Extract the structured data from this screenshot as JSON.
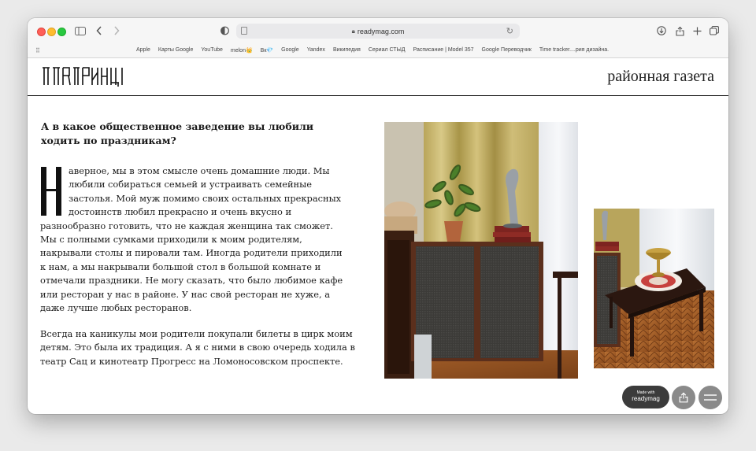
{
  "browser": {
    "url": "readymag.com",
    "favorites": [
      "Apple",
      "Карты Google",
      "YouTube",
      "melon👑",
      "Вк💎",
      "Google",
      "Yandex",
      "Википедия",
      "Сериал СТЫД",
      "Расписание | Model 357",
      "Google Переводчик",
      "Time tracker....рия дизайна."
    ]
  },
  "site": {
    "tagline": "районная газета"
  },
  "article": {
    "question": "А в какое общественное заведение вы любили ходить по праздникам?",
    "paragraph1_rest": "аверное, мы в этом смысле очень домашние люди. Мы любили собираться семьей и устраивать семейные застолья. Мой муж помимо своих остальных прекрасных достоинств любил прекрасно и очень вкусно и разнообразно готовить, что не каждая женщина так сможет. Мы с полными сумками приходили к моим родителям, накрывали столы и пировали там. Иногда родители приходили к нам, а мы накрывали большой стол в большой комнате и отмечали праздники. Не могу сказать, что было любимое кафе или ресторан у нас в районе. У нас свой ресторан не хуже, а даже лучше любых ресторанов.",
    "paragraph2": "Всегда на каникулы мои родители покупали билеты в цирк моим детям. Это была их традиция. А я с ними в свою очередь ходила в театр Сац и кинотеатр Прогресс на Ломоносовском проспекте."
  },
  "footer": {
    "made_with_small": "Made with",
    "made_with_brand": "readymag"
  },
  "icons": {
    "lock": "lock-icon",
    "sidebar": "sidebar-icon",
    "back": "chevron-left-icon",
    "forward": "chevron-right-icon",
    "privacy": "shield-icon",
    "download": "download-icon",
    "share": "share-icon",
    "new_tab": "plus-icon",
    "tabs": "tabs-overview-icon",
    "menu": "hamburger-menu-icon"
  },
  "colors": {
    "window_bg": "#ffffff",
    "toolbar_bg": "#f6f6f6",
    "text": "#1c1c1c",
    "button_dark": "#3b3b3b",
    "button_gray": "#8a8a8a"
  }
}
